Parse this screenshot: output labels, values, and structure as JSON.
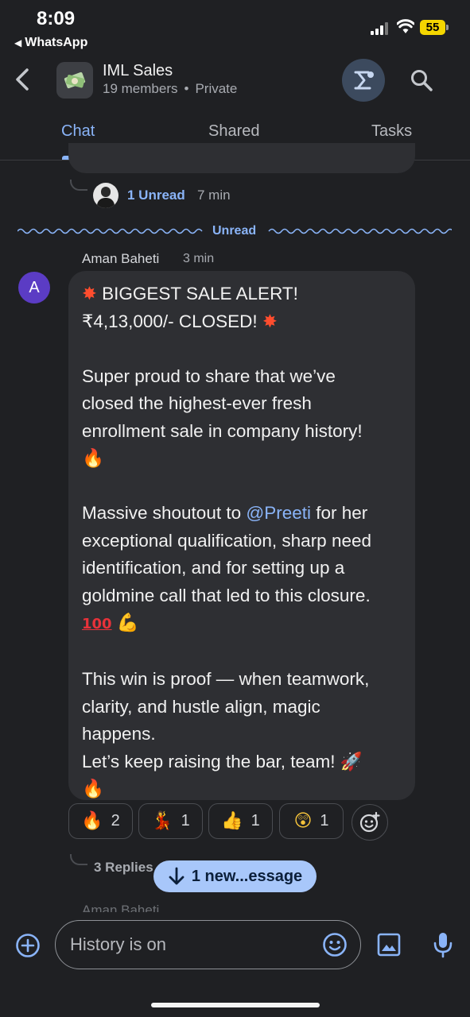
{
  "status_bar": {
    "time": "8:09",
    "back_app": "WhatsApp",
    "battery": "55"
  },
  "header": {
    "group_name": "IML Sales",
    "members": "19 members",
    "privacy": "Private"
  },
  "tabs": [
    {
      "label": "Chat",
      "active": true
    },
    {
      "label": "Shared",
      "active": false
    },
    {
      "label": "Tasks",
      "active": false
    }
  ],
  "previous_thread": {
    "unread": "1 Unread",
    "time": "7 min"
  },
  "divider_label": "Unread",
  "message": {
    "sender": "Aman Baheti",
    "time": "3 min",
    "avatar_letter": "A",
    "line1": "BIGGEST SALE ALERT!",
    "line2": "₹4,13,000/- CLOSED!",
    "para1": [
      "Super proud to share that we’ve",
      "closed the highest-ever fresh",
      "enrollment sale in company history!"
    ],
    "para2_start": "Massive shoutout to ",
    "mention": "@Preeti",
    "para2_end": " for her",
    "para2": [
      "exceptional qualification, sharp need",
      "identification, and for setting up a",
      "goldmine call that led to this closure."
    ],
    "para3": [
      "This win is proof — when teamwork,",
      "clarity, and hustle align, magic",
      "happens.",
      "Let’s keep raising the bar, team!"
    ],
    "emojis": {
      "boom": "✸",
      "fire": "🔥",
      "hundred": "100",
      "arm": "💪",
      "rocket": "🚀"
    }
  },
  "reactions": [
    {
      "emoji": "🔥",
      "name": "fire",
      "count": "2"
    },
    {
      "emoji": "💃",
      "name": "dancer",
      "count": "1"
    },
    {
      "emoji": "👍",
      "name": "thumbs-up",
      "count": "1"
    },
    {
      "emoji": "😲",
      "name": "astonished",
      "count": "1"
    }
  ],
  "replies": "3 Replies",
  "new_message_pill": "1 new...essage",
  "next_sender": "Aman Baheti",
  "composer": {
    "placeholder": "History is on"
  },
  "colors": {
    "background": "#1f2023",
    "bubble": "#2e2f33",
    "accent": "#8ab4f8",
    "pill": "#a8c7fa",
    "avatar": "#5b3cc4"
  }
}
